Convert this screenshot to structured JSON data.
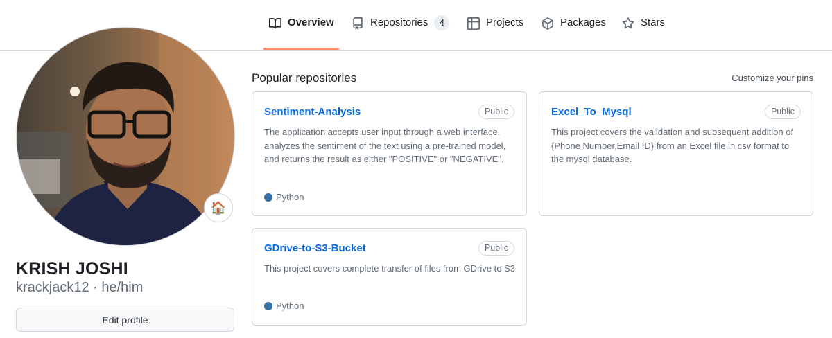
{
  "nav": {
    "tabs": [
      {
        "label": "Overview",
        "icon": "book-icon",
        "active": true
      },
      {
        "label": "Repositories",
        "icon": "repo-icon",
        "count": "4"
      },
      {
        "label": "Projects",
        "icon": "table-icon"
      },
      {
        "label": "Packages",
        "icon": "package-icon"
      },
      {
        "label": "Stars",
        "icon": "star-icon"
      }
    ],
    "active_underline_color": "#fd8c73"
  },
  "profile": {
    "name": "KRISH JOSHI",
    "login": "krackjack12 · he/him",
    "status_emoji": "🏠",
    "edit_label": "Edit profile"
  },
  "pinned": {
    "title": "Popular repositories",
    "customize_label": "Customize your pins",
    "repos": [
      {
        "name": "Sentiment-Analysis",
        "visibility": "Public",
        "description": "The application accepts user input through a web interface, analyzes the sentiment of the text using a pre-trained model, and returns the result as either \"POSITIVE\" or \"NEGATIVE\".",
        "language": "Python",
        "language_color": "#3572A5"
      },
      {
        "name": "Excel_To_Mysql",
        "visibility": "Public",
        "description": "This project covers the validation and subsequent addition of {Phone Number,Email ID} from an Excel file in csv format to the mysql database."
      },
      {
        "name": "GDrive-to-S3-Bucket",
        "visibility": "Public",
        "description": "This project covers complete transfer of files from GDrive to S3",
        "language": "Python",
        "language_color": "#3572A5"
      }
    ]
  },
  "colors": {
    "link": "#0969da",
    "border": "#d0d7de",
    "muted": "#636c76"
  }
}
